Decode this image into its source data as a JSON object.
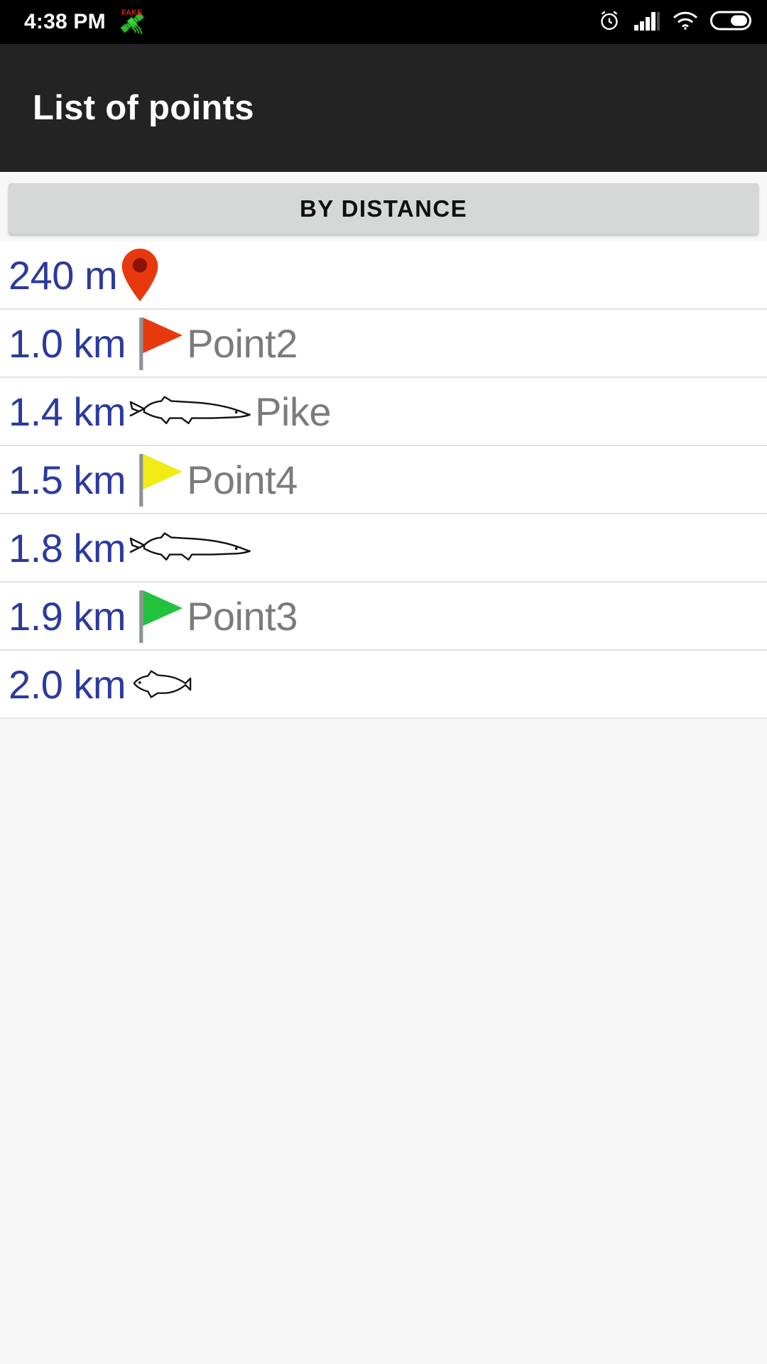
{
  "status_bar": {
    "time": "4:38 PM",
    "fake_badge": "FAKE",
    "icons": [
      "satellite-fake-icon",
      "alarm-icon",
      "signal-icon",
      "wifi-icon",
      "battery-icon"
    ],
    "background": "#000000"
  },
  "app_bar": {
    "title": "List of points",
    "background": "#232323",
    "text_color": "#ffffff"
  },
  "sort_button": {
    "label": "BY DISTANCE",
    "background": "#d6d8d7",
    "text_color": "#101010"
  },
  "list": {
    "distance_color": "#2b3a9e",
    "name_color": "#7b7b7b",
    "rows": [
      {
        "distance": "240 m",
        "icon": "map-pin-icon",
        "icon_color": "#e8380d",
        "name": ""
      },
      {
        "distance": "1.0 km",
        "icon": "flag-icon",
        "icon_color": "#e8380d",
        "name": "Point2"
      },
      {
        "distance": "1.4 km",
        "icon": "pike-fish-icon",
        "icon_color": "#1a1a1a",
        "name": "Pike"
      },
      {
        "distance": "1.5 km",
        "icon": "flag-icon",
        "icon_color": "#f2eb15",
        "name": "Point4"
      },
      {
        "distance": "1.8 km",
        "icon": "pike-fish-icon",
        "icon_color": "#1a1a1a",
        "name": ""
      },
      {
        "distance": "1.9 km",
        "icon": "flag-icon",
        "icon_color": "#22c23e",
        "name": "Point3"
      },
      {
        "distance": "2.0 km",
        "icon": "perch-fish-icon",
        "icon_color": "#1a1a1a",
        "name": ""
      }
    ]
  }
}
